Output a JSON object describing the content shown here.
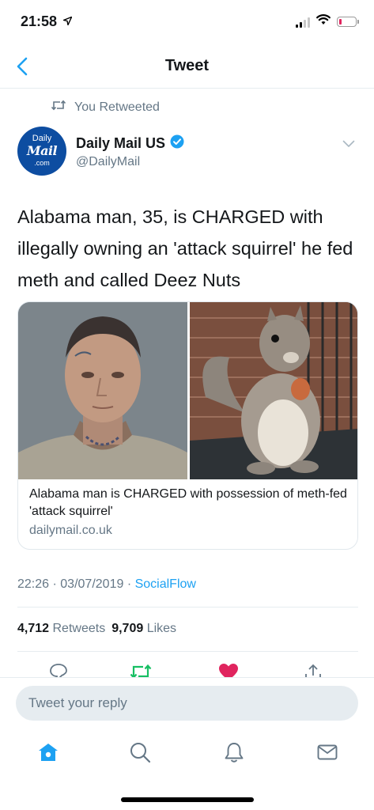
{
  "status_bar": {
    "time": "21:58"
  },
  "nav": {
    "title": "Tweet"
  },
  "retweet_context": "You Retweeted",
  "author": {
    "name": "Daily Mail US",
    "handle": "@DailyMail",
    "avatar_line1": "Daily",
    "avatar_line2": "Mail",
    "avatar_line3": ".com"
  },
  "tweet": {
    "text": "Alabama man, 35, is CHARGED with illegally owning an 'attack squirrel' he fed meth and called Deez Nuts",
    "time": "22:26",
    "date": "03/07/2019",
    "source": "SocialFlow"
  },
  "card": {
    "title": "Alabama man is CHARGED with possession of meth-fed 'attack squirrel'",
    "domain": "dailymail.co.uk",
    "image_left": "mugshot-photo",
    "image_right": "squirrel-photo"
  },
  "stats": {
    "retweets_count": "4,712",
    "retweets_label": "Retweets",
    "likes_count": "9,709",
    "likes_label": "Likes"
  },
  "reply": {
    "placeholder": "Tweet your reply"
  },
  "colors": {
    "accent": "#1da1f2",
    "retweet_green": "#17bf63",
    "like_red": "#e0245e",
    "muted": "#657786"
  }
}
